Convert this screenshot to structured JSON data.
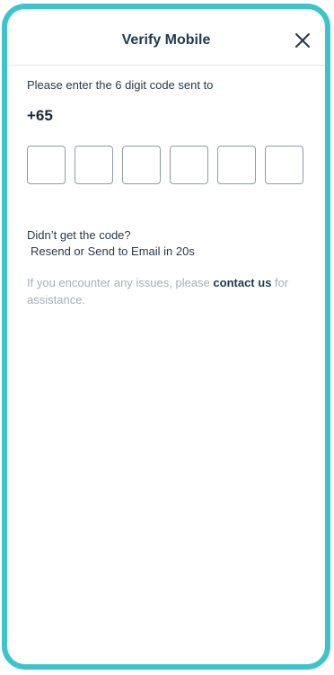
{
  "header": {
    "title": "Verify Mobile",
    "close_icon": "close-icon"
  },
  "verification": {
    "prompt": "Please enter the 6 digit code sent to",
    "phone": "+65",
    "code_digits": [
      "",
      "",
      "",
      "",
      "",
      ""
    ]
  },
  "resend": {
    "question": "Didn’t get the code?",
    "action_text": "Resend or Send to Email in 20s"
  },
  "help": {
    "prefix": "If you encounter any issues, please ",
    "link": "contact us",
    "suffix": " for assistance."
  },
  "colors": {
    "frame_border": "#3cc4cc",
    "title_text": "#1e3a50",
    "link_text": "#1e3a50",
    "muted_text": "#a7b0b6",
    "input_border": "#8e9ca6"
  }
}
